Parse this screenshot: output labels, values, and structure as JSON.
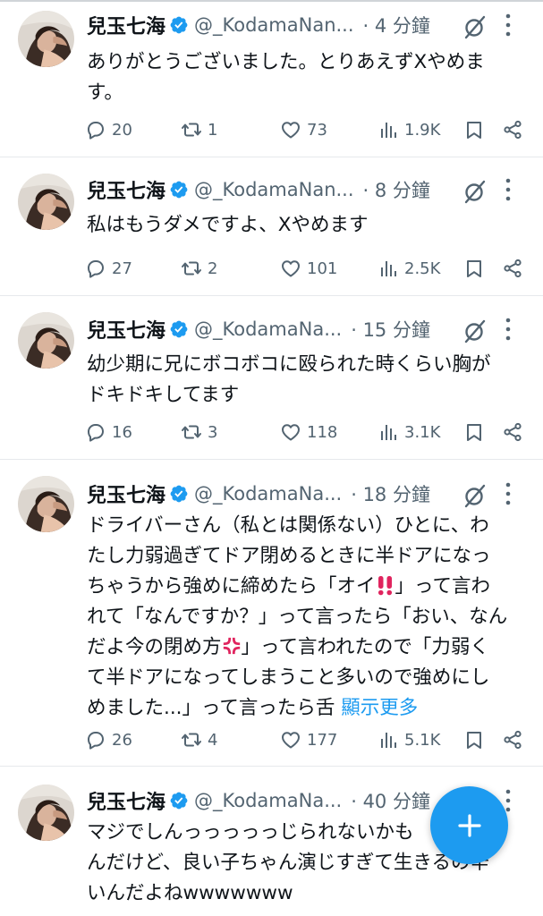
{
  "colors": {
    "accent": "#1d9bf0",
    "secondary_text": "#536471",
    "text": "#0f1419"
  },
  "tweets": [
    {
      "name": "兒玉七海",
      "handle": "@_KodamaNan...",
      "time": "· 4 分鐘",
      "lines": [
        "ありがとうございました。とりあえずXやめま",
        "す。"
      ],
      "replies": "20",
      "retweets": "1",
      "likes": "73",
      "views": "1.9K"
    },
    {
      "name": "兒玉七海",
      "handle": "@_KodamaNan...",
      "time": "· 8 分鐘",
      "lines": [
        "私はもうダメですよ、Xやめます"
      ],
      "replies": "27",
      "retweets": "2",
      "likes": "101",
      "views": "2.5K"
    },
    {
      "name": "兒玉七海",
      "handle": "@_KodamaNa...",
      "time": "· 15 分鐘",
      "lines": [
        "幼少期に兄にボコボコに殴られた時くらい胸が",
        "ドキドキしてます"
      ],
      "replies": "16",
      "retweets": "3",
      "likes": "118",
      "views": "3.1K"
    },
    {
      "name": "兒玉七海",
      "handle": "@_KodamaNa...",
      "time": "· 18 分鐘",
      "line1": "ドライバーさん（私とは関係ない）ひとに、わ",
      "line2": "たし力弱過ぎてドア閉めるときに半ドアになっ",
      "line3a": "ちゃうから強めに締めたら「オイ",
      "line3b": "」って言わ",
      "line4": "れて「なんですか？」って言ったら「おい、なん",
      "line5a": "だよ今の閉め方",
      "line5b": "」って言われたので「力弱く",
      "line6": "て半ドアになってしまうこと多いので強めにし",
      "line7": "めました...」って言ったら舌",
      "show_more": "顯示更多",
      "replies": "26",
      "retweets": "4",
      "likes": "177",
      "views": "5.1K"
    },
    {
      "name": "兒玉七海",
      "handle": "@_KodamaNa...",
      "time": "· 40 分鐘",
      "lines": [
        "マジでしんっっっっっじられないかも",
        "んだけど、良い子ちゃん演じすぎて生きるの辛",
        "いんだよねwwwwwww"
      ]
    }
  ],
  "icons": {
    "verified": "verified-badge-icon",
    "grok": "grok-icon",
    "more": "more-vertical-icon",
    "reply": "reply-icon",
    "retweet": "retweet-icon",
    "like": "heart-icon",
    "views": "views-icon",
    "bookmark": "bookmark-icon",
    "share": "share-icon",
    "fab": "plus-icon",
    "emoji1": "double-exclamation-emoji",
    "emoji2": "anger-symbol-emoji"
  }
}
